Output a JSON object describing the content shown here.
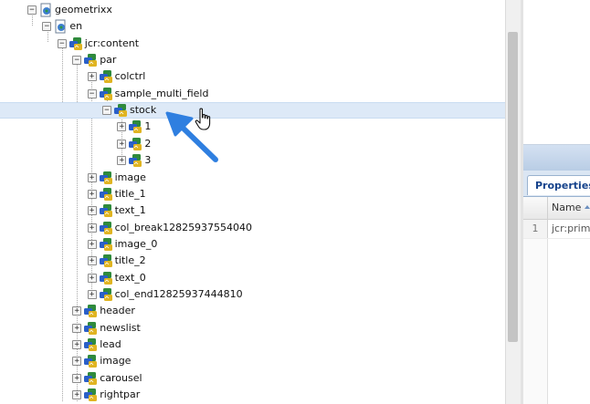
{
  "tree": {
    "nodes": [
      {
        "label": "geometrixx",
        "icon": "page-icon",
        "toggle": "−"
      },
      {
        "label": "en",
        "icon": "page-icon",
        "toggle": "−"
      },
      {
        "label": "jcr:content",
        "icon": "node-icon",
        "toggle": "−"
      },
      {
        "label": "par",
        "icon": "node-icon",
        "toggle": "−"
      },
      {
        "label": "colctrl",
        "icon": "node-icon",
        "toggle": "+"
      },
      {
        "label": "sample_multi_field",
        "icon": "node-icon",
        "toggle": "−"
      },
      {
        "label": "stock",
        "icon": "node-icon",
        "toggle": "−",
        "selected": true
      },
      {
        "label": "1",
        "icon": "node-icon",
        "toggle": "+"
      },
      {
        "label": "2",
        "icon": "node-icon",
        "toggle": "+"
      },
      {
        "label": "3",
        "icon": "node-icon",
        "toggle": "+"
      },
      {
        "label": "image",
        "icon": "node-icon",
        "toggle": "+"
      },
      {
        "label": "title_1",
        "icon": "node-icon",
        "toggle": "+"
      },
      {
        "label": "text_1",
        "icon": "node-icon",
        "toggle": "+"
      },
      {
        "label": "col_break12825937554040",
        "icon": "node-icon",
        "toggle": "+"
      },
      {
        "label": "image_0",
        "icon": "node-icon",
        "toggle": "+"
      },
      {
        "label": "title_2",
        "icon": "node-icon",
        "toggle": "+"
      },
      {
        "label": "text_0",
        "icon": "node-icon",
        "toggle": "+"
      },
      {
        "label": "col_end12825937444810",
        "icon": "node-icon",
        "toggle": "+"
      },
      {
        "label": "header",
        "icon": "node-icon",
        "toggle": "+"
      },
      {
        "label": "newslist",
        "icon": "node-icon",
        "toggle": "+"
      },
      {
        "label": "lead",
        "icon": "node-icon",
        "toggle": "+"
      },
      {
        "label": "image",
        "icon": "node-icon",
        "toggle": "+"
      },
      {
        "label": "carousel",
        "icon": "node-icon",
        "toggle": "+"
      },
      {
        "label": "rightpar",
        "icon": "node-icon",
        "toggle": "+"
      }
    ]
  },
  "properties_panel": {
    "tab_label": "Properties",
    "column_header": "Name",
    "rows": [
      {
        "number": "1",
        "name": "jcr:prima"
      }
    ]
  },
  "colors": {
    "selection": "#dde9f7",
    "annotation_arrow": "#2f7fe0"
  }
}
